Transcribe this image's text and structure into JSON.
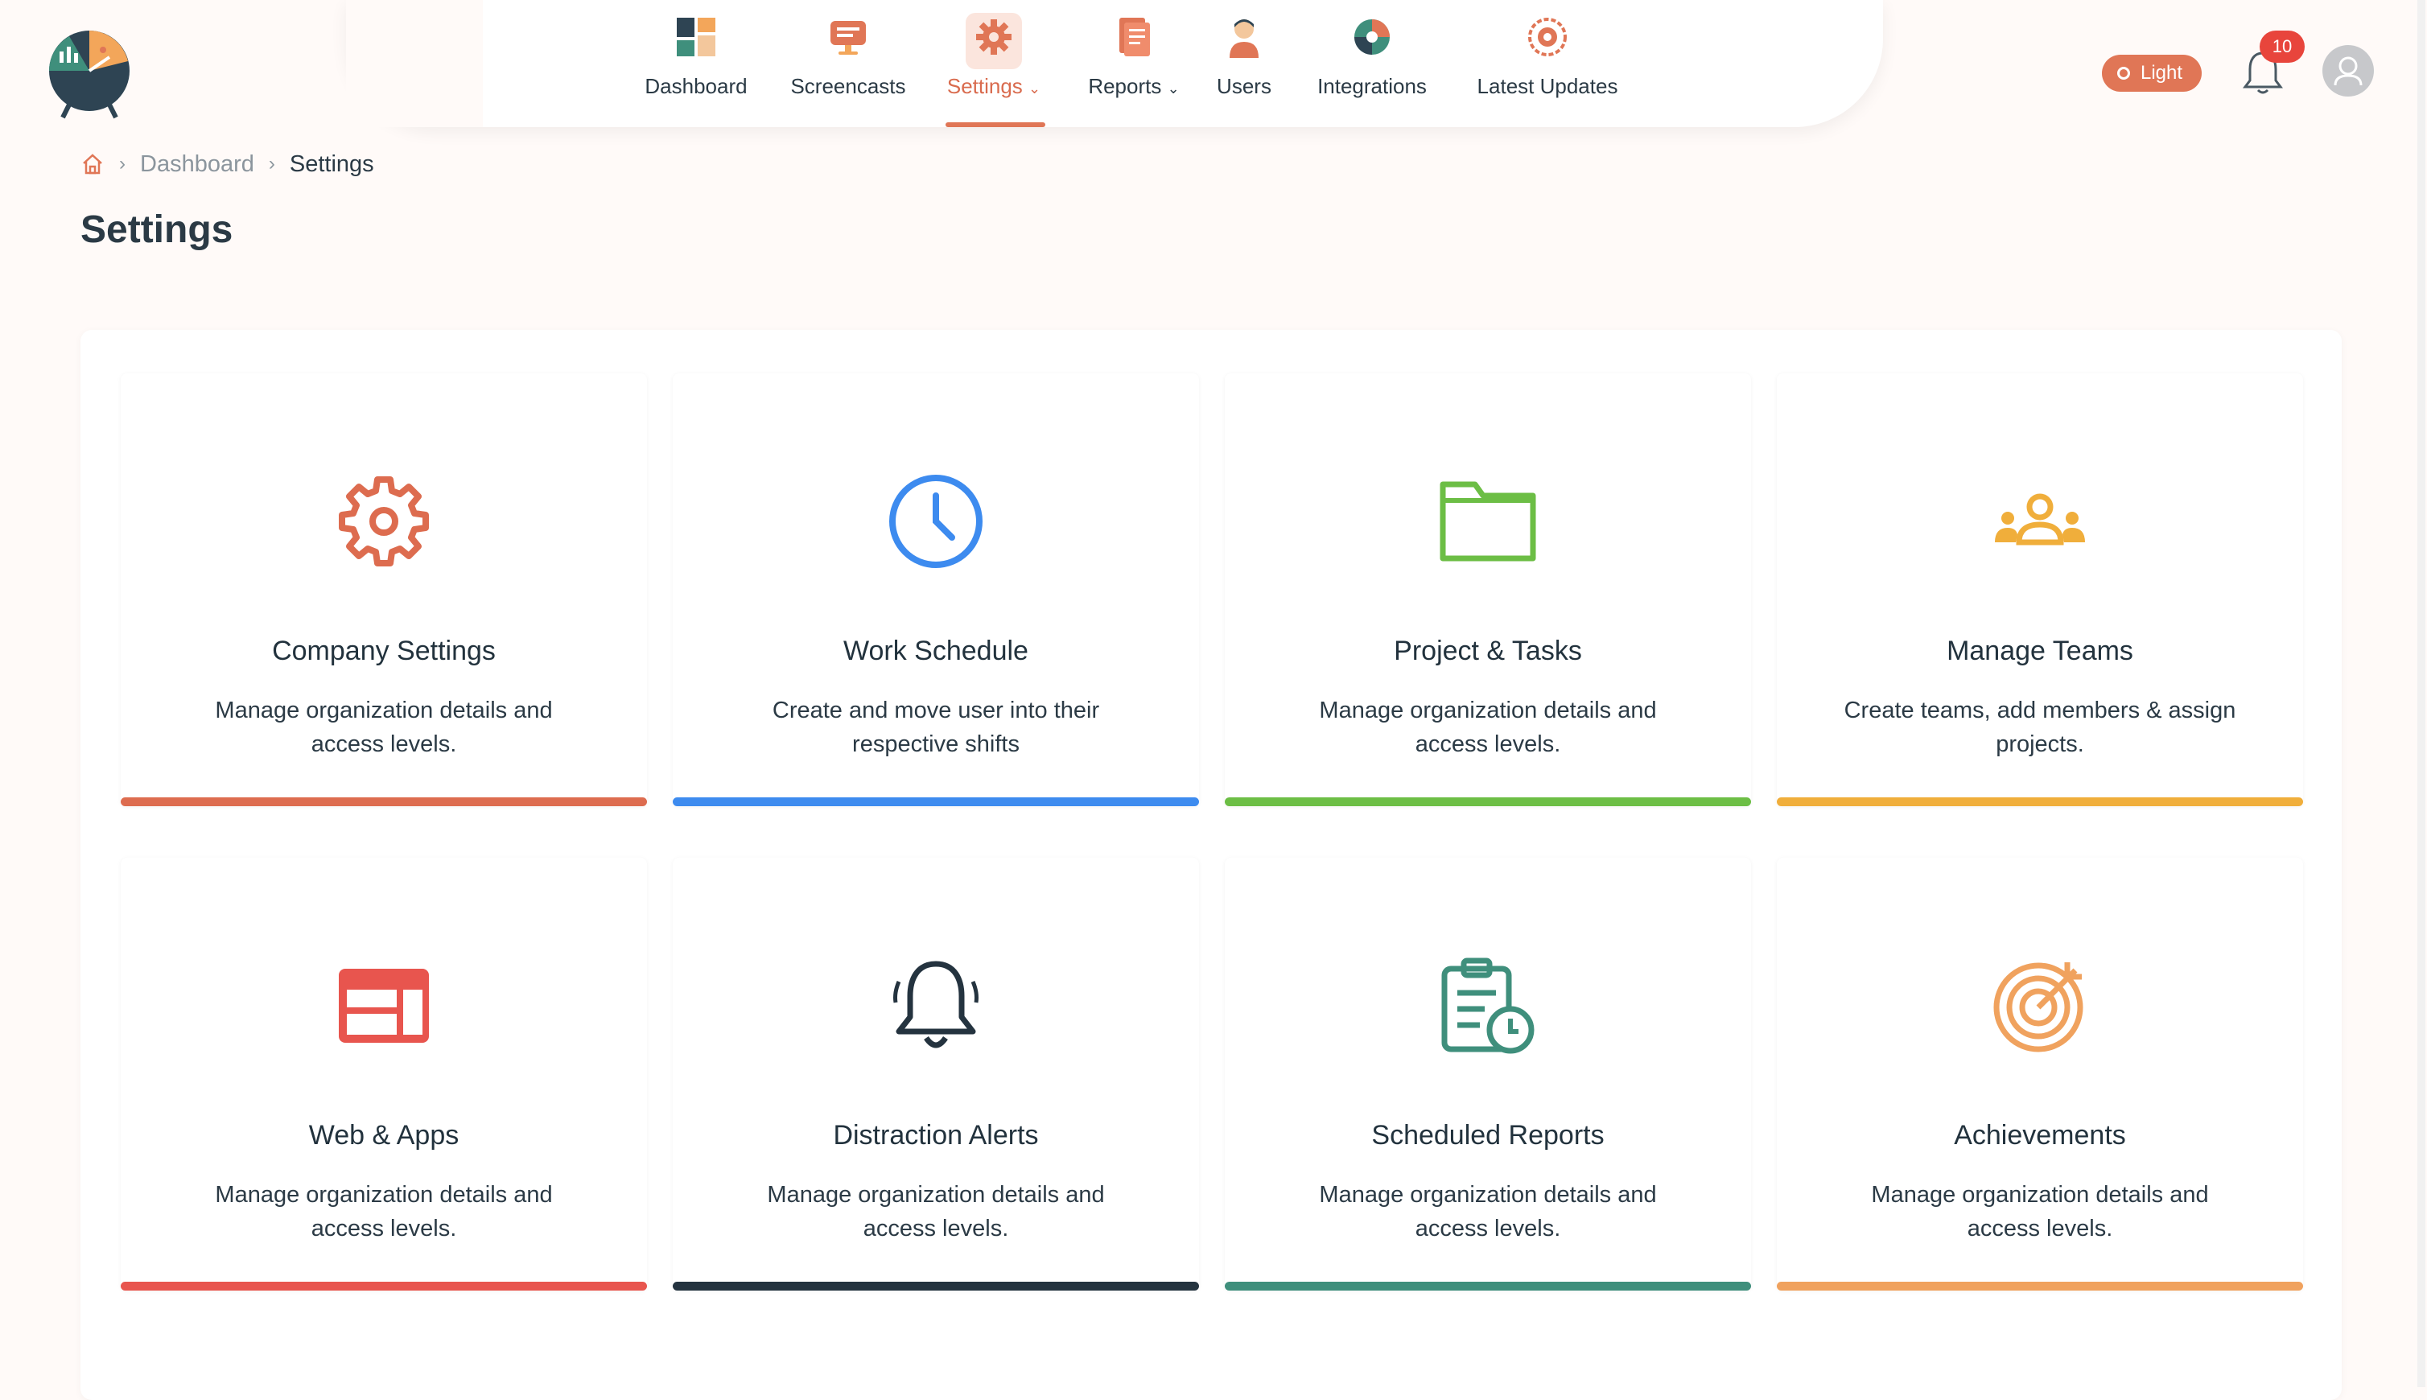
{
  "nav": {
    "items": [
      {
        "label": "Dashboard",
        "icon": "dashboard-icon"
      },
      {
        "label": "Screencasts",
        "icon": "screencast-icon"
      },
      {
        "label": "Settings",
        "icon": "settings-icon",
        "active": true,
        "dropdown": true
      },
      {
        "label": "Reports",
        "icon": "reports-icon",
        "dropdown": true
      },
      {
        "label": "Users",
        "icon": "user-icon"
      },
      {
        "label": "Integrations",
        "icon": "integrations-icon"
      },
      {
        "label": "Latest Updates",
        "icon": "updates-icon"
      }
    ]
  },
  "topbar": {
    "theme_label": "Light",
    "notification_count": "10"
  },
  "breadcrumb": {
    "items": [
      "Dashboard",
      "Settings"
    ]
  },
  "page": {
    "title": "Settings"
  },
  "cards": [
    {
      "title": "Company Settings",
      "desc": "Manage organization details and access levels.",
      "icon": "gear-icon",
      "color": "#dd6c4f"
    },
    {
      "title": "Work Schedule",
      "desc": "Create and move user into their respective shifts",
      "icon": "clock-icon",
      "color": "#3d8bef"
    },
    {
      "title": "Project & Tasks",
      "desc": "Manage organization details and access levels.",
      "icon": "folder-icon",
      "color": "#6cbe45"
    },
    {
      "title": "Manage Teams",
      "desc": "Create teams, add members & assign projects.",
      "icon": "team-icon",
      "color": "#f0ae3b"
    },
    {
      "title": "Web & Apps",
      "desc": "Manage organization details and access levels.",
      "icon": "web-apps-icon",
      "color": "#e8554e"
    },
    {
      "title": "Distraction Alerts",
      "desc": "Manage organization details and access levels.",
      "icon": "bell-icon",
      "color": "#24333f"
    },
    {
      "title": "Scheduled Reports",
      "desc": "Manage organization details and access levels.",
      "icon": "clipboard-clock-icon",
      "color": "#3f8f7c"
    },
    {
      "title": "Achievements",
      "desc": "Manage organization details and access levels.",
      "icon": "target-icon",
      "color": "#f0a25e"
    }
  ]
}
